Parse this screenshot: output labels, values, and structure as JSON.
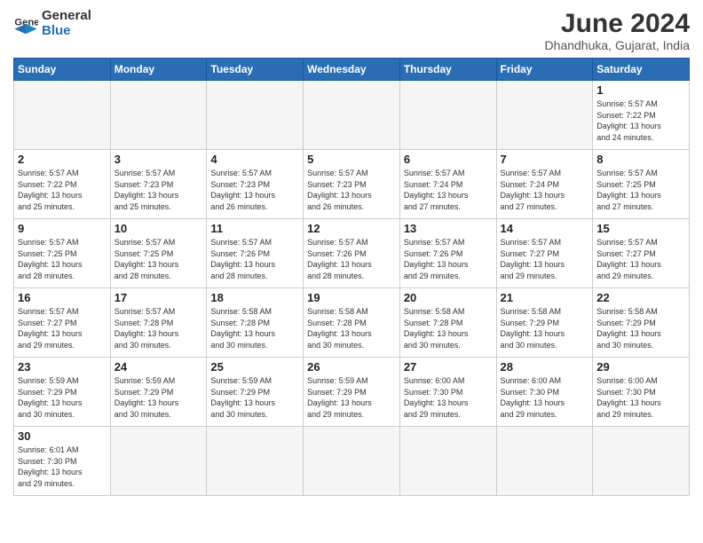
{
  "header": {
    "logo_general": "General",
    "logo_blue": "Blue",
    "title": "June 2024",
    "subtitle": "Dhandhuka, Gujarat, India"
  },
  "weekdays": [
    "Sunday",
    "Monday",
    "Tuesday",
    "Wednesday",
    "Thursday",
    "Friday",
    "Saturday"
  ],
  "days": {
    "d1": {
      "num": "1",
      "info": "Sunrise: 5:57 AM\nSunset: 7:22 PM\nDaylight: 13 hours and 24 minutes."
    },
    "d2": {
      "num": "2",
      "info": "Sunrise: 5:57 AM\nSunset: 7:22 PM\nDaylight: 13 hours and 25 minutes."
    },
    "d3": {
      "num": "3",
      "info": "Sunrise: 5:57 AM\nSunset: 7:23 PM\nDaylight: 13 hours and 25 minutes."
    },
    "d4": {
      "num": "4",
      "info": "Sunrise: 5:57 AM\nSunset: 7:23 PM\nDaylight: 13 hours and 26 minutes."
    },
    "d5": {
      "num": "5",
      "info": "Sunrise: 5:57 AM\nSunset: 7:23 PM\nDaylight: 13 hours and 26 minutes."
    },
    "d6": {
      "num": "6",
      "info": "Sunrise: 5:57 AM\nSunset: 7:24 PM\nDaylight: 13 hours and 27 minutes."
    },
    "d7": {
      "num": "7",
      "info": "Sunrise: 5:57 AM\nSunset: 7:24 PM\nDaylight: 13 hours and 27 minutes."
    },
    "d8": {
      "num": "8",
      "info": "Sunrise: 5:57 AM\nSunset: 7:25 PM\nDaylight: 13 hours and 27 minutes."
    },
    "d9": {
      "num": "9",
      "info": "Sunrise: 5:57 AM\nSunset: 7:25 PM\nDaylight: 13 hours and 28 minutes."
    },
    "d10": {
      "num": "10",
      "info": "Sunrise: 5:57 AM\nSunset: 7:25 PM\nDaylight: 13 hours and 28 minutes."
    },
    "d11": {
      "num": "11",
      "info": "Sunrise: 5:57 AM\nSunset: 7:26 PM\nDaylight: 13 hours and 28 minutes."
    },
    "d12": {
      "num": "12",
      "info": "Sunrise: 5:57 AM\nSunset: 7:26 PM\nDaylight: 13 hours and 28 minutes."
    },
    "d13": {
      "num": "13",
      "info": "Sunrise: 5:57 AM\nSunset: 7:26 PM\nDaylight: 13 hours and 29 minutes."
    },
    "d14": {
      "num": "14",
      "info": "Sunrise: 5:57 AM\nSunset: 7:27 PM\nDaylight: 13 hours and 29 minutes."
    },
    "d15": {
      "num": "15",
      "info": "Sunrise: 5:57 AM\nSunset: 7:27 PM\nDaylight: 13 hours and 29 minutes."
    },
    "d16": {
      "num": "16",
      "info": "Sunrise: 5:57 AM\nSunset: 7:27 PM\nDaylight: 13 hours and 29 minutes."
    },
    "d17": {
      "num": "17",
      "info": "Sunrise: 5:57 AM\nSunset: 7:28 PM\nDaylight: 13 hours and 30 minutes."
    },
    "d18": {
      "num": "18",
      "info": "Sunrise: 5:58 AM\nSunset: 7:28 PM\nDaylight: 13 hours and 30 minutes."
    },
    "d19": {
      "num": "19",
      "info": "Sunrise: 5:58 AM\nSunset: 7:28 PM\nDaylight: 13 hours and 30 minutes."
    },
    "d20": {
      "num": "20",
      "info": "Sunrise: 5:58 AM\nSunset: 7:28 PM\nDaylight: 13 hours and 30 minutes."
    },
    "d21": {
      "num": "21",
      "info": "Sunrise: 5:58 AM\nSunset: 7:29 PM\nDaylight: 13 hours and 30 minutes."
    },
    "d22": {
      "num": "22",
      "info": "Sunrise: 5:58 AM\nSunset: 7:29 PM\nDaylight: 13 hours and 30 minutes."
    },
    "d23": {
      "num": "23",
      "info": "Sunrise: 5:59 AM\nSunset: 7:29 PM\nDaylight: 13 hours and 30 minutes."
    },
    "d24": {
      "num": "24",
      "info": "Sunrise: 5:59 AM\nSunset: 7:29 PM\nDaylight: 13 hours and 30 minutes."
    },
    "d25": {
      "num": "25",
      "info": "Sunrise: 5:59 AM\nSunset: 7:29 PM\nDaylight: 13 hours and 30 minutes."
    },
    "d26": {
      "num": "26",
      "info": "Sunrise: 5:59 AM\nSunset: 7:29 PM\nDaylight: 13 hours and 29 minutes."
    },
    "d27": {
      "num": "27",
      "info": "Sunrise: 6:00 AM\nSunset: 7:30 PM\nDaylight: 13 hours and 29 minutes."
    },
    "d28": {
      "num": "28",
      "info": "Sunrise: 6:00 AM\nSunset: 7:30 PM\nDaylight: 13 hours and 29 minutes."
    },
    "d29": {
      "num": "29",
      "info": "Sunrise: 6:00 AM\nSunset: 7:30 PM\nDaylight: 13 hours and 29 minutes."
    },
    "d30": {
      "num": "30",
      "info": "Sunrise: 6:01 AM\nSunset: 7:30 PM\nDaylight: 13 hours and 29 minutes."
    }
  }
}
